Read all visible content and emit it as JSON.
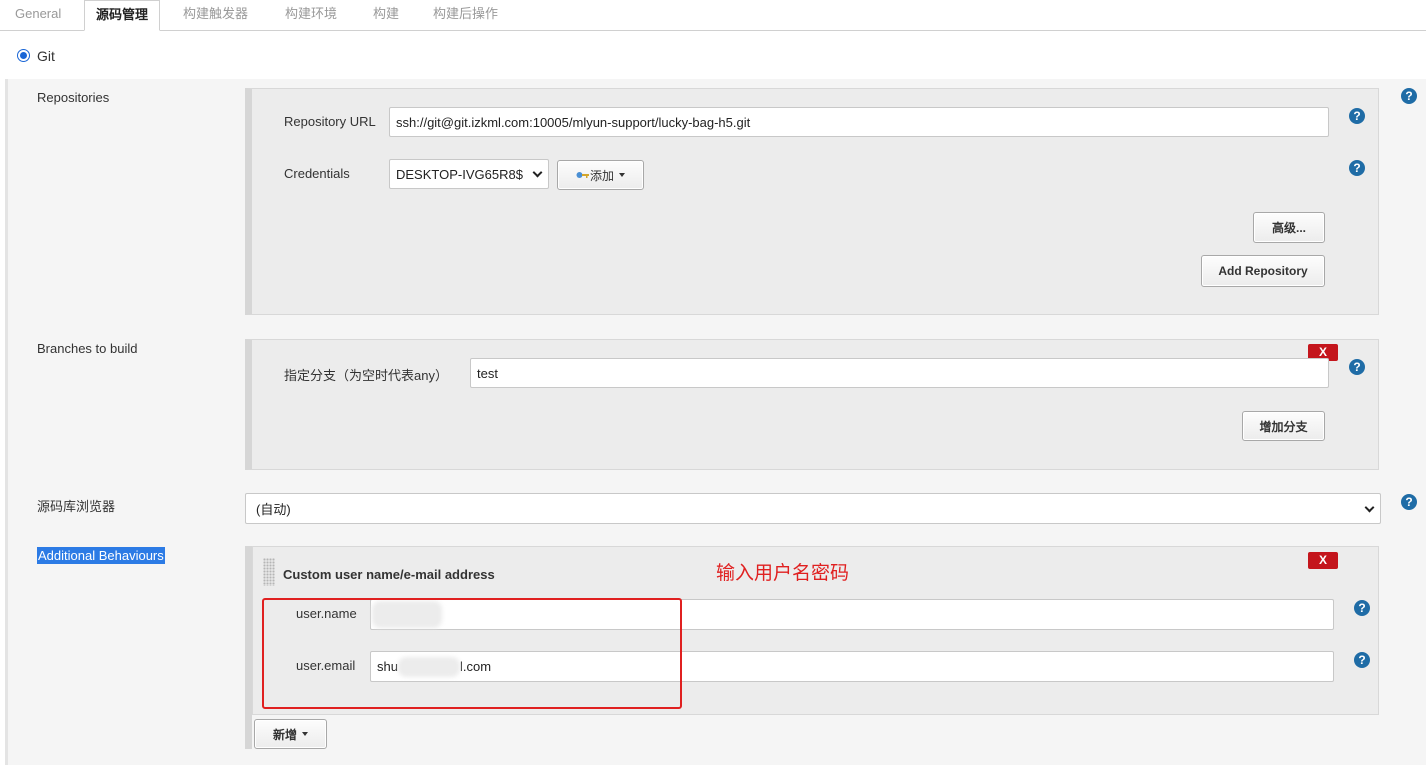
{
  "tabs": [
    {
      "label": "General"
    },
    {
      "label": "源码管理"
    },
    {
      "label": "构建触发器"
    },
    {
      "label": "构建环境"
    },
    {
      "label": "构建"
    },
    {
      "label": "构建后操作"
    }
  ],
  "scm": {
    "git_label": "Git"
  },
  "repositories": {
    "section_label": "Repositories",
    "url_label": "Repository URL",
    "url_value": "ssh://git@git.izkml.com:10005/mlyun-support/lucky-bag-h5.git",
    "credentials_label": "Credentials",
    "credentials_value": "DESKTOP-IVG65R8$",
    "add_label": "添加",
    "advanced_label": "高级...",
    "add_repository_label": "Add Repository"
  },
  "branches": {
    "section_label": "Branches to build",
    "branch_label": "指定分支（为空时代表any）",
    "branch_value": "test",
    "add_branch_label": "增加分支",
    "delete_label": "X"
  },
  "browser": {
    "label": "源码库浏览器",
    "value": "(自动)"
  },
  "behaviours": {
    "section_label": "Additional Behaviours",
    "custom_title": "Custom user name/e-mail address",
    "annotation": "输入用户名密码",
    "username_label": "user.name",
    "username_value": "",
    "email_label": "user.email",
    "email_value_prefix": "shu",
    "email_value_suffix": "l.com",
    "add_new_label": "新增",
    "delete_label": "X"
  },
  "help_icon_text": "?",
  "colors": {
    "accent": "#1a66d6",
    "help": "#1f6ca6",
    "danger": "#c4151c",
    "annotation": "#e02020"
  }
}
